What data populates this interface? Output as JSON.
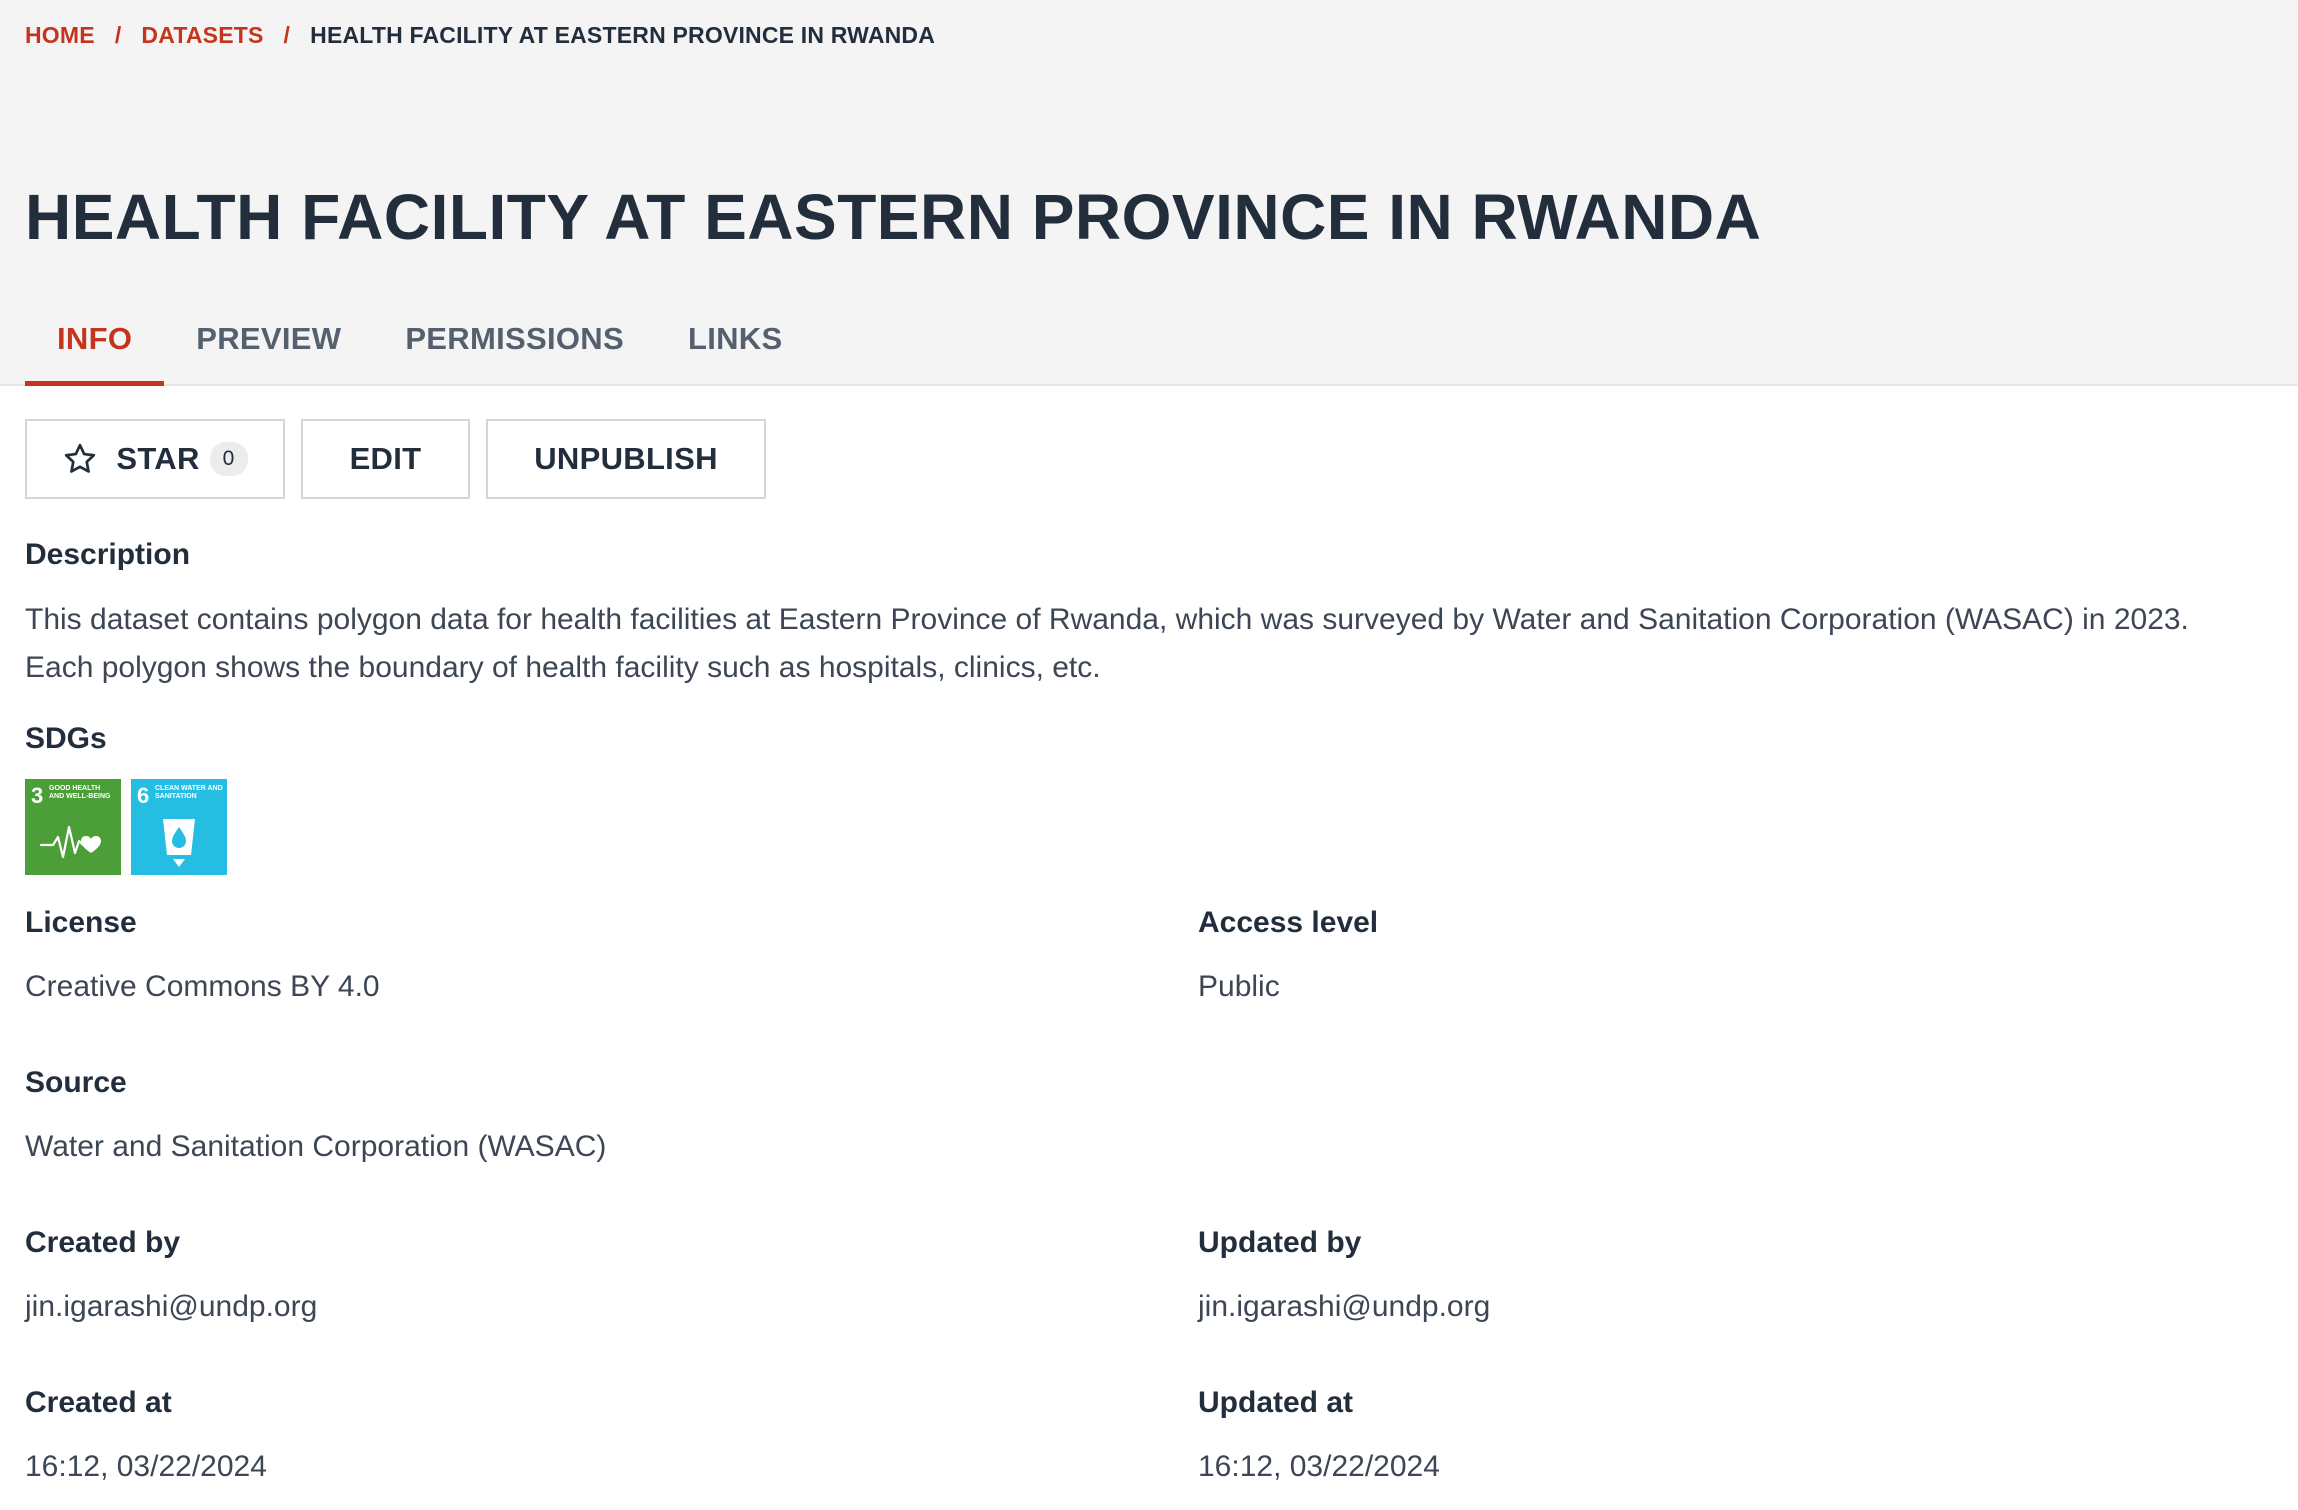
{
  "breadcrumb": {
    "home": "HOME",
    "datasets": "DATASETS",
    "current": "HEALTH FACILITY AT EASTERN PROVINCE IN RWANDA",
    "separator": "/"
  },
  "page_title": "HEALTH FACILITY AT EASTERN PROVINCE IN RWANDA",
  "tabs": [
    {
      "label": "INFO",
      "active": true
    },
    {
      "label": "PREVIEW",
      "active": false
    },
    {
      "label": "PERMISSIONS",
      "active": false
    },
    {
      "label": "LINKS",
      "active": false
    }
  ],
  "actions": {
    "star_label": "STAR",
    "star_count": "0",
    "star_icon": "star-outline-icon",
    "edit_label": "EDIT",
    "unpublish_label": "UNPUBLISH"
  },
  "description": {
    "label": "Description",
    "line1": "This dataset contains polygon data for health facilities at Eastern Province of Rwanda, which was surveyed by Water and Sanitation Corporation (WASAC) in 2023.",
    "line2": "Each polygon shows the boundary of health facility such as hospitals, clinics, etc."
  },
  "sdgs": {
    "label": "SDGs",
    "items": [
      {
        "number": "3",
        "title": "GOOD HEALTH AND WELL-BEING",
        "color": "#4c9f38",
        "icon": "heartbeat-icon"
      },
      {
        "number": "6",
        "title": "CLEAN WATER AND SANITATION",
        "color": "#26bde2",
        "icon": "water-glass-icon"
      }
    ]
  },
  "fields": {
    "license": {
      "label": "License",
      "value": "Creative Commons BY 4.0"
    },
    "access_level": {
      "label": "Access level",
      "value": "Public"
    },
    "source": {
      "label": "Source",
      "value": "Water and Sanitation Corporation (WASAC)"
    },
    "created_by": {
      "label": "Created by",
      "value": "jin.igarashi@undp.org"
    },
    "updated_by": {
      "label": "Updated by",
      "value": "jin.igarashi@undp.org"
    },
    "created_at": {
      "label": "Created at",
      "value": "16:12, 03/22/2024"
    },
    "updated_at": {
      "label": "Updated at",
      "value": "16:12, 03/22/2024"
    }
  },
  "colors": {
    "accent": "#c5351d",
    "text": "#232e3d",
    "header_bg": "#f4f4f4"
  }
}
